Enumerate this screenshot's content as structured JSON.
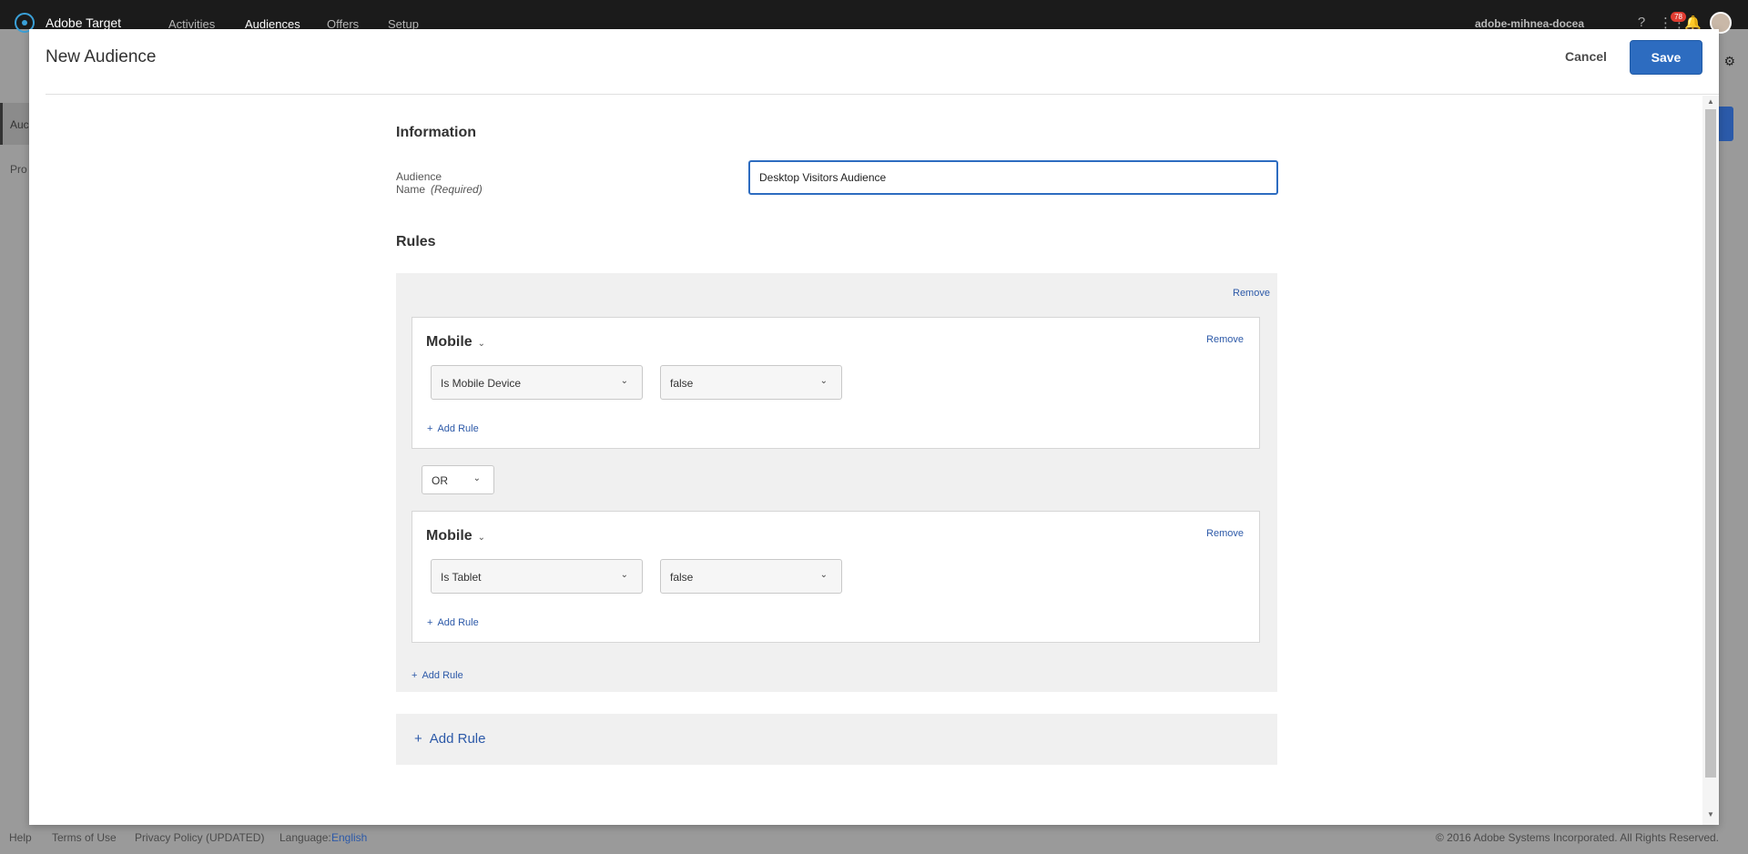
{
  "topbar": {
    "brand": "Adobe Target",
    "nav": [
      "Activities",
      "Audiences",
      "Offers",
      "Setup"
    ],
    "active_nav": "Audiences",
    "user": "adobe-mihnea-docea",
    "notification_count": "78"
  },
  "background": {
    "sidebar_item_1": "Auc",
    "sidebar_item_2": "Pro"
  },
  "footer": {
    "help": "Help",
    "terms": "Terms of Use",
    "privacy": "Privacy Policy (UPDATED)",
    "language_label": "Language:",
    "language_value": "English",
    "copyright": "© 2016 Adobe Systems Incorporated. All Rights Reserved."
  },
  "modal": {
    "title": "New Audience",
    "cancel_label": "Cancel",
    "save_label": "Save",
    "information_title": "Information",
    "audience_name_label": "Audience Name",
    "required_label": "(Required)",
    "audience_name_value": "Desktop Visitors Audience",
    "rules_title": "Rules",
    "remove_outer": "Remove",
    "groups": [
      {
        "category": "Mobile",
        "remove": "Remove",
        "attribute": "Is Mobile Device",
        "value": "false",
        "add_rule": "Add Rule"
      },
      {
        "category": "Mobile",
        "remove": "Remove",
        "attribute": "Is Tablet",
        "value": "false",
        "add_rule": "Add Rule"
      }
    ],
    "operator": "OR",
    "add_rule_inner": "Add Rule",
    "add_rule_outer": "Add Rule"
  }
}
